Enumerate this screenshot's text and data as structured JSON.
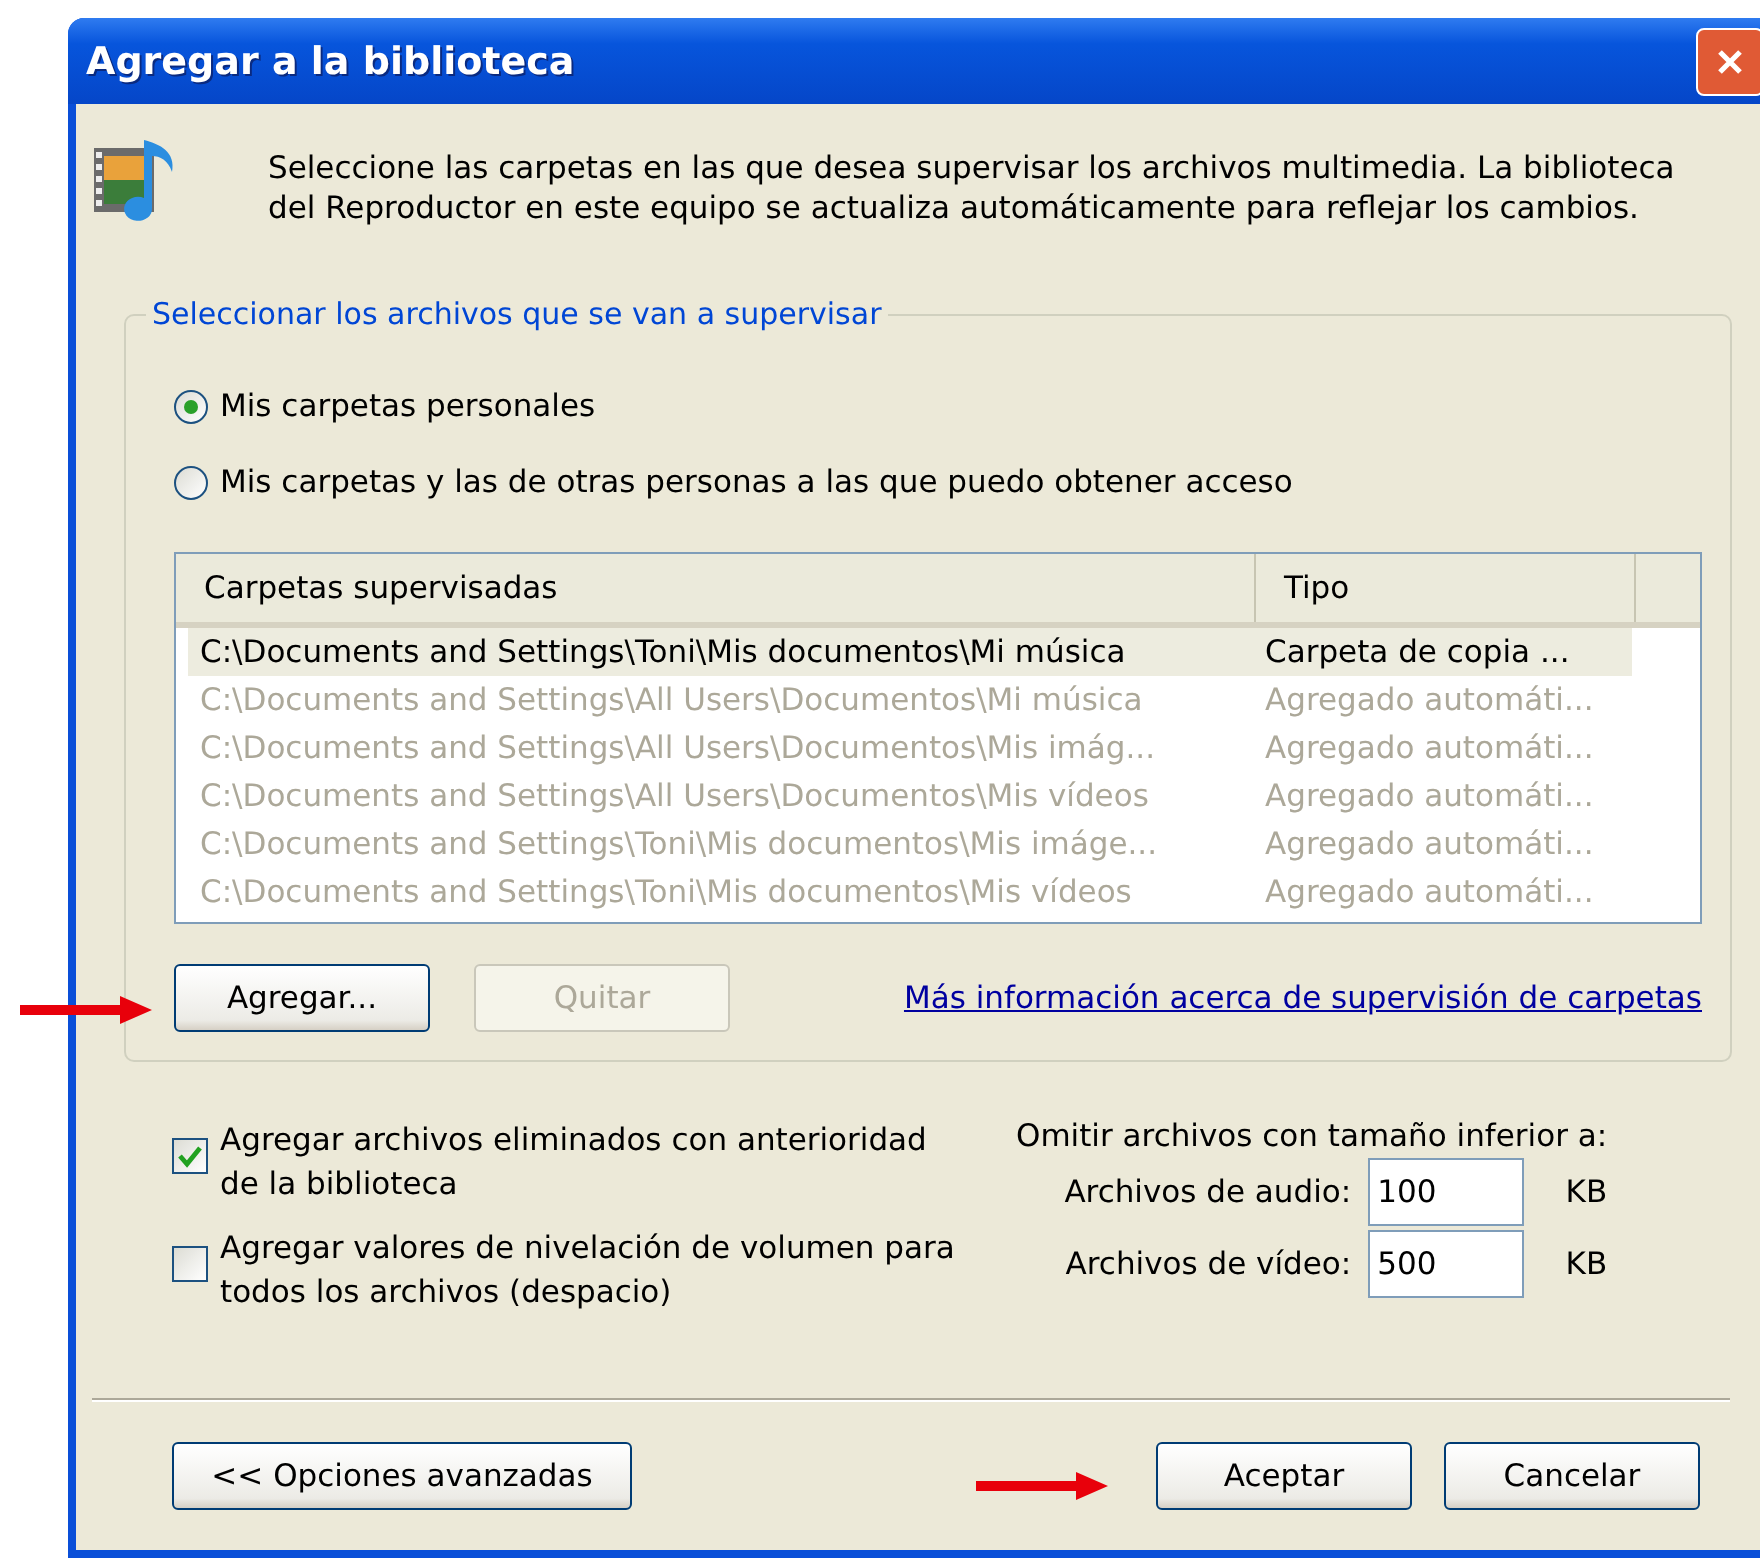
{
  "window": {
    "title": "Agregar a la biblioteca"
  },
  "intro": "Seleccione las carpetas en las que desea supervisar los archivos multimedia. La biblioteca del Reproductor en este equipo se actualiza automáticamente para reflejar los cambios.",
  "group": {
    "title": "Seleccionar los archivos que se van a supervisar",
    "radios": [
      {
        "label": "Mis carpetas personales",
        "selected": true
      },
      {
        "label": "Mis carpetas y las de otras personas a las que puedo obtener acceso",
        "selected": false
      }
    ],
    "table": {
      "columns": [
        "Carpetas supervisadas",
        "Tipo"
      ],
      "rows": [
        {
          "cells": [
            "C:\\Documents and Settings\\Toni\\Mis documentos\\Mi música",
            "Carpeta de copia ..."
          ],
          "disabled": false,
          "selected": true
        },
        {
          "cells": [
            "C:\\Documents and Settings\\All Users\\Documentos\\Mi música",
            "Agregado automáti..."
          ],
          "disabled": true,
          "selected": false
        },
        {
          "cells": [
            "C:\\Documents and Settings\\All Users\\Documentos\\Mis imág...",
            "Agregado automáti..."
          ],
          "disabled": true,
          "selected": false
        },
        {
          "cells": [
            "C:\\Documents and Settings\\All Users\\Documentos\\Mis vídeos",
            "Agregado automáti..."
          ],
          "disabled": true,
          "selected": false
        },
        {
          "cells": [
            "C:\\Documents and Settings\\Toni\\Mis documentos\\Mis imáge...",
            "Agregado automáti..."
          ],
          "disabled": true,
          "selected": false
        },
        {
          "cells": [
            "C:\\Documents and Settings\\Toni\\Mis documentos\\Mis vídeos",
            "Agregado automáti..."
          ],
          "disabled": true,
          "selected": false
        }
      ]
    },
    "buttons": [
      {
        "label": "Agregar...",
        "disabled": false
      },
      {
        "label": "Quitar",
        "disabled": true
      }
    ],
    "link": "Más información acerca de supervisión de carpetas"
  },
  "checkboxes": [
    {
      "label": "Agregar archivos eliminados con anterioridad de la biblioteca",
      "checked": true
    },
    {
      "label": "Agregar valores de nivelación de volumen para todos los archivos (despacio)",
      "checked": false
    }
  ],
  "size_limits": {
    "title": "Omitir archivos con tamaño inferior a:",
    "fields": [
      {
        "label": "Archivos de audio:",
        "value": "100",
        "unit": "KB"
      },
      {
        "label": "Archivos de vídeo:",
        "value": "500",
        "unit": "KB"
      }
    ]
  },
  "footer_buttons": [
    {
      "label": "<< Opciones avanzadas"
    },
    {
      "label": "Aceptar"
    },
    {
      "label": "Cancelar"
    }
  ]
}
